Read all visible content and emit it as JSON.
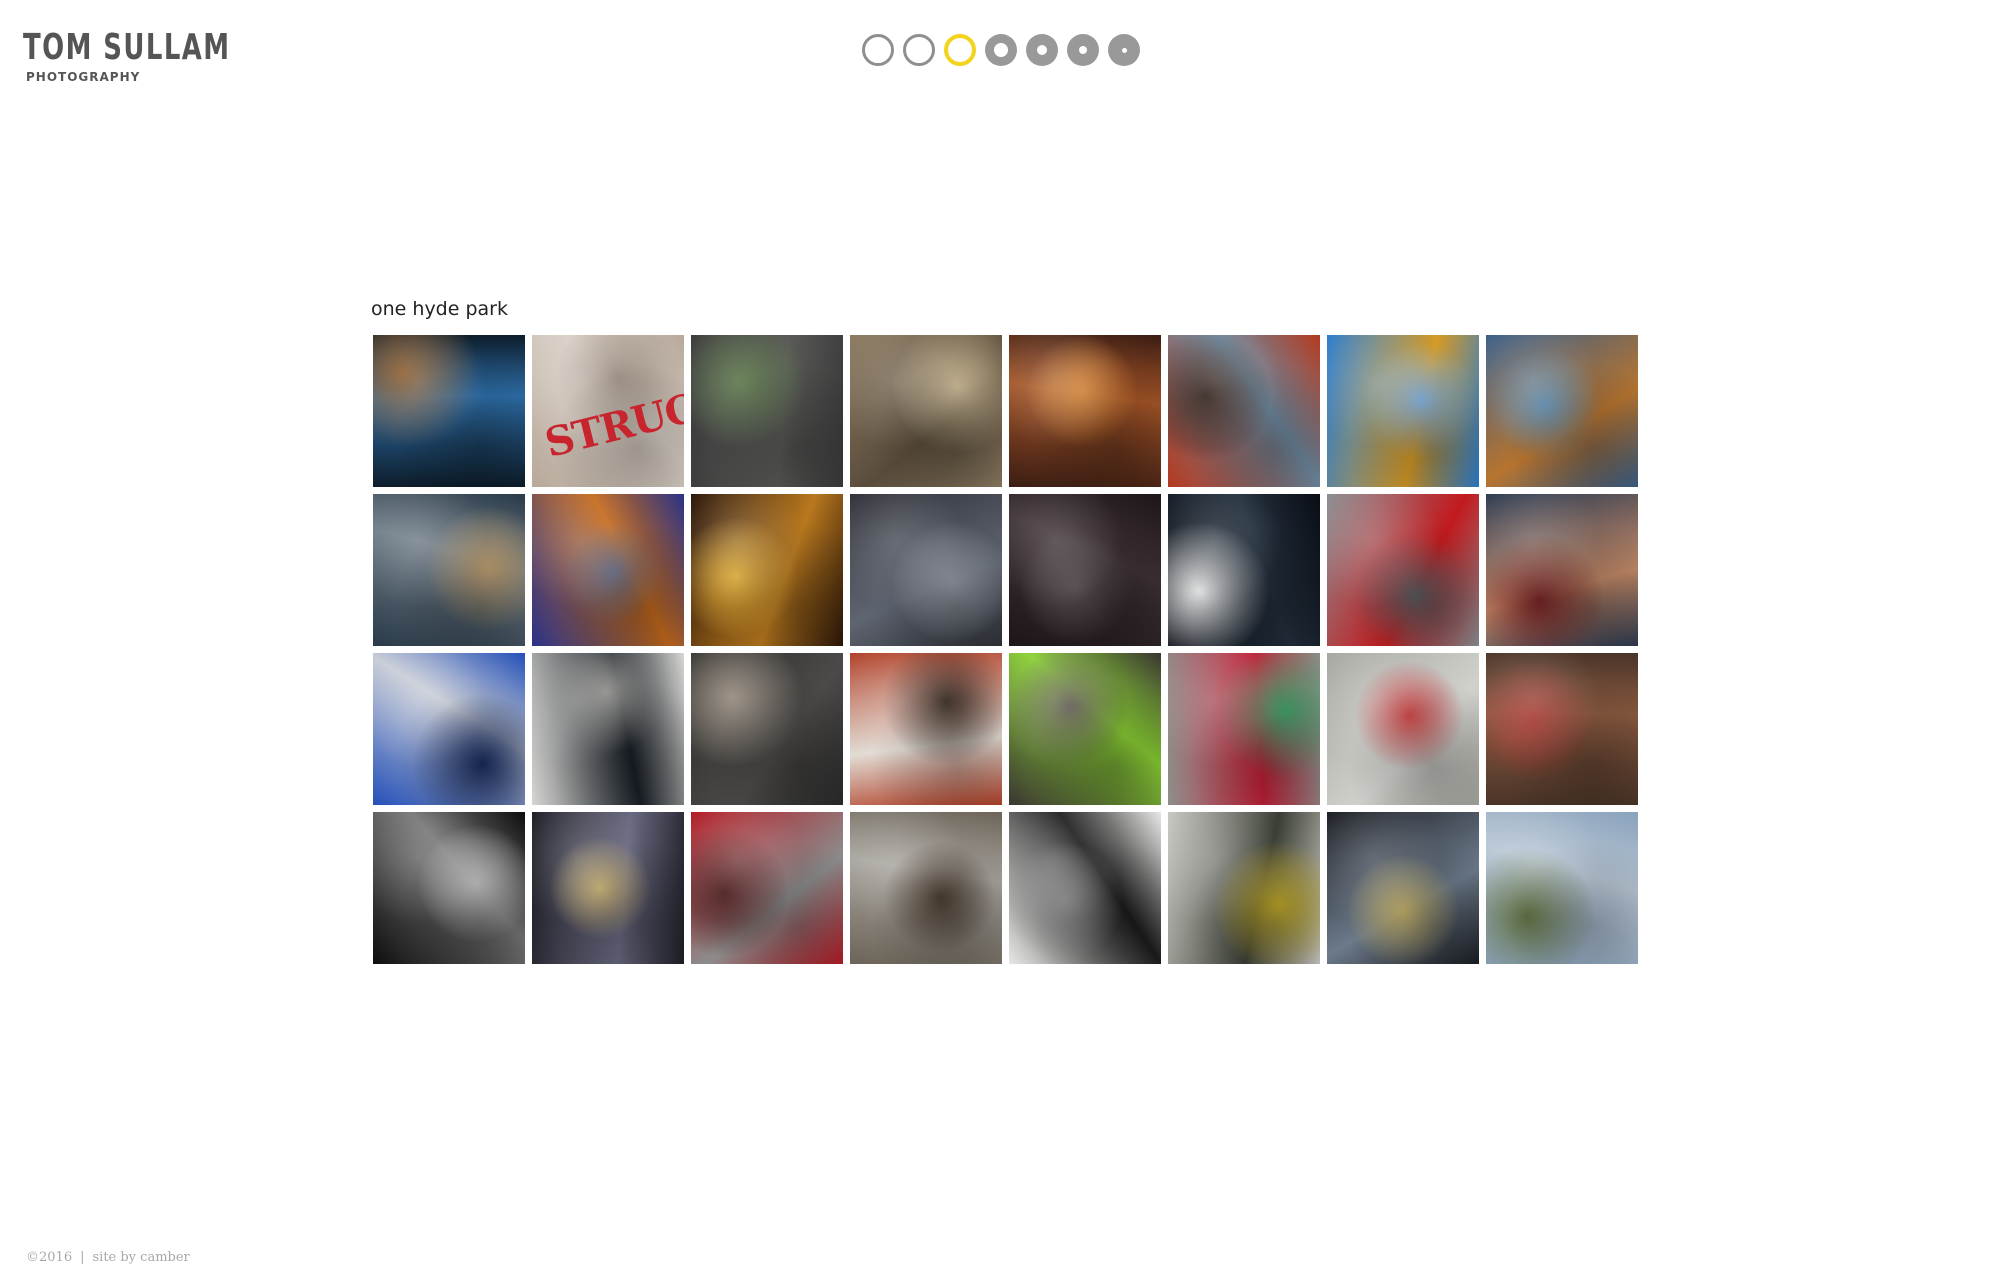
{
  "logo": {
    "name": "TOM SULLAM",
    "subtitle": "PHOTOGRAPHY"
  },
  "gallery_nav": {
    "dots": [
      {
        "style": "outline",
        "hole": 0
      },
      {
        "style": "outline",
        "hole": 0
      },
      {
        "style": "active",
        "hole": 0
      },
      {
        "style": "ring",
        "hole": 14
      },
      {
        "style": "ring",
        "hole": 10
      },
      {
        "style": "ring",
        "hole": 8
      },
      {
        "style": "ring",
        "hole": 5
      }
    ],
    "active_index": 2,
    "accent_color": "#f3d31b",
    "dot_color": "#999999"
  },
  "gallery": {
    "title": "one hyde park",
    "thumbnails": [
      {
        "subject": "steel pipes",
        "colors": [
          "#0d1d2b",
          "#2d6ea8",
          "#8a5a2a"
        ]
      },
      {
        "subject": "structural stencil",
        "colors": [
          "#b7a89a",
          "#d8cfc6",
          "#9a8c80"
        ],
        "label": "STRUCTURA"
      },
      {
        "subject": "hanging bag",
        "colors": [
          "#3a3a3a",
          "#5a5a58",
          "#4d6a3a"
        ]
      },
      {
        "subject": "chain on board",
        "colors": [
          "#8b7a60",
          "#5a4c3c",
          "#c9b894"
        ]
      },
      {
        "subject": "rusty bracket",
        "colors": [
          "#3b1d14",
          "#a35427",
          "#d88a3c"
        ]
      },
      {
        "subject": "rebar ties",
        "colors": [
          "#b43a20",
          "#6e8aa0",
          "#2a1a12"
        ]
      },
      {
        "subject": "yellow excavator arm",
        "colors": [
          "#2b7ccc",
          "#d59a26",
          "#7fb0e0"
        ]
      },
      {
        "subject": "blue chains",
        "colors": [
          "#3a5e86",
          "#b7742f",
          "#5a8ab0"
        ]
      },
      {
        "subject": "telescope tubes",
        "colors": [
          "#2a3a48",
          "#6e7b86",
          "#c0a070"
        ]
      },
      {
        "subject": "rusty disc",
        "colors": [
          "#2a3288",
          "#c56a1c",
          "#6c7390"
        ]
      },
      {
        "subject": "gold chain",
        "colors": [
          "#2a1508",
          "#b8781e",
          "#e2b03c"
        ]
      },
      {
        "subject": "steel beam at dusk",
        "colors": [
          "#2f3138",
          "#5f6571",
          "#9aa0aa"
        ]
      },
      {
        "subject": "site at night",
        "colors": [
          "#1d1518",
          "#3e3236",
          "#5e5458"
        ]
      },
      {
        "subject": "worker in hard hat",
        "colors": [
          "#0a0d14",
          "#23303e",
          "#e5e5e5"
        ]
      },
      {
        "subject": "red valves",
        "colors": [
          "#8a8e92",
          "#c21a1e",
          "#5c6064"
        ]
      },
      {
        "subject": "smiling worker",
        "colors": [
          "#2c3a50",
          "#c48a68",
          "#6c1e20"
        ]
      },
      {
        "subject": "blue crates",
        "colors": [
          "#2450b8",
          "#c8ccd6",
          "#1b2f66"
        ]
      },
      {
        "subject": "white beam angle",
        "colors": [
          "#d6d6d2",
          "#1a2028",
          "#8c8c88"
        ]
      },
      {
        "subject": "rods in gravel",
        "colors": [
          "#2a2a2a",
          "#4c4a48",
          "#8a7e70"
        ]
      },
      {
        "subject": "workers in hats",
        "colors": [
          "#b04028",
          "#e2dcd4",
          "#3a2e26"
        ]
      },
      {
        "subject": "workers in mud",
        "colors": [
          "#3a3632",
          "#8ad034",
          "#5e5650"
        ]
      },
      {
        "subject": "gloves on concrete",
        "colors": [
          "#8e8e8a",
          "#c42038",
          "#3f9e6a"
        ]
      },
      {
        "subject": "hoarding tape",
        "colors": [
          "#a6a6a0",
          "#d0d0cc",
          "#c8383a"
        ]
      },
      {
        "subject": "steel blocks",
        "colors": [
          "#4a3428",
          "#8a5a40",
          "#a8352e"
        ]
      },
      {
        "subject": "saw blade edge",
        "colors": [
          "#0e0e0e",
          "#767676",
          "#c4c4c4"
        ]
      },
      {
        "subject": "rebar mesh",
        "colors": [
          "#1e1e26",
          "#6a6a82",
          "#c8b070"
        ]
      },
      {
        "subject": "wheelbarrow",
        "colors": [
          "#b21a24",
          "#8c8c8c",
          "#4a1a1a"
        ]
      },
      {
        "subject": "boots in mud",
        "colors": [
          "#6c6458",
          "#a8a49e",
          "#4a3c2e"
        ]
      },
      {
        "subject": "crane lattice",
        "colors": [
          "#e8e8e6",
          "#1c1c1c",
          "#8a8a8a"
        ]
      },
      {
        "subject": "worker on ladder",
        "colors": [
          "#c8c8c2",
          "#3a3e34",
          "#c8b02a"
        ]
      },
      {
        "subject": "mesh facade",
        "colors": [
          "#1a1c22",
          "#6c7a8a",
          "#c8b46a"
        ]
      },
      {
        "subject": "hoisted skip",
        "colors": [
          "#8aa2bc",
          "#b8c6d4",
          "#5a6a3a"
        ]
      }
    ]
  },
  "footer": {
    "copyright": "©2016",
    "separator": "|",
    "credit": "site by camber"
  }
}
